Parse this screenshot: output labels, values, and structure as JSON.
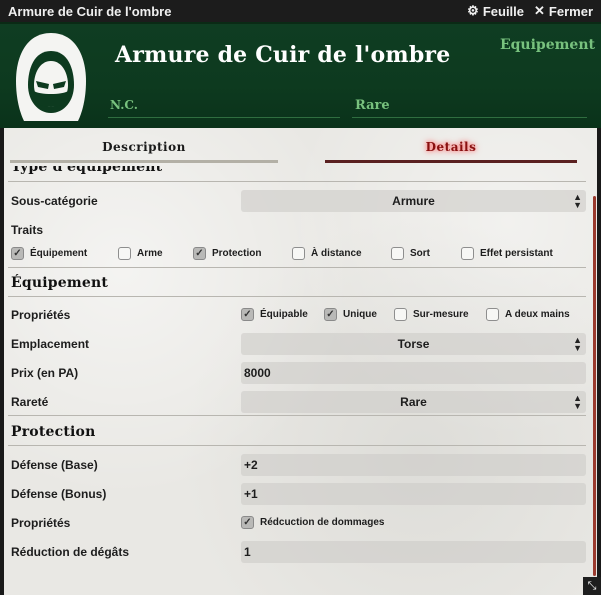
{
  "window": {
    "title": "Armure de Cuir de l'ombre",
    "sheet_label": "Feuille",
    "close_label": "Fermer",
    "sheet_icon": "gear-icon",
    "close_icon": "close-icon"
  },
  "header": {
    "name": "Armure de Cuir de l'ombre",
    "type": "Equipement",
    "level": "N.C.",
    "rarity": "Rare",
    "avatar_icon": "hooded-figure-icon",
    "colors": {
      "bg": "#0f3d22",
      "accent": "#78c27e"
    }
  },
  "tabs": {
    "description": "Description",
    "details": "Details",
    "active": "details"
  },
  "details": {
    "type_section": {
      "title_partial": "Type d'équipement",
      "subcategory_label": "Sous-catégorie",
      "subcategory_value": "Armure",
      "traits_label": "Traits",
      "traits": [
        {
          "label": "Équipement",
          "checked": true
        },
        {
          "label": "Arme",
          "checked": false
        },
        {
          "label": "Protection",
          "checked": true
        },
        {
          "label": "À distance",
          "checked": false
        },
        {
          "label": "Sort",
          "checked": false
        },
        {
          "label": "Effet persistant",
          "checked": false
        }
      ]
    },
    "equipment_section": {
      "title": "Équipement",
      "properties_label": "Propriétés",
      "properties": [
        {
          "label": "Équipable",
          "checked": true
        },
        {
          "label": "Unique",
          "checked": true
        },
        {
          "label": "Sur-mesure",
          "checked": false
        },
        {
          "label": "A deux mains",
          "checked": false
        }
      ],
      "slot_label": "Emplacement",
      "slot_value": "Torse",
      "price_label": "Prix (en PA)",
      "price_value": "8000",
      "rarity_label": "Rareté",
      "rarity_value": "Rare"
    },
    "protection_section": {
      "title": "Protection",
      "defense_base_label": "Défense (Base)",
      "defense_base_value": "+2",
      "defense_bonus_label": "Défense (Bonus)",
      "defense_bonus_value": "+1",
      "properties_label": "Propriétés",
      "damage_reduction_check": {
        "label": "Rédcuction de dommages",
        "checked": true
      },
      "damage_reduction_label": "Réduction de dégâts",
      "damage_reduction_value": "1"
    }
  }
}
